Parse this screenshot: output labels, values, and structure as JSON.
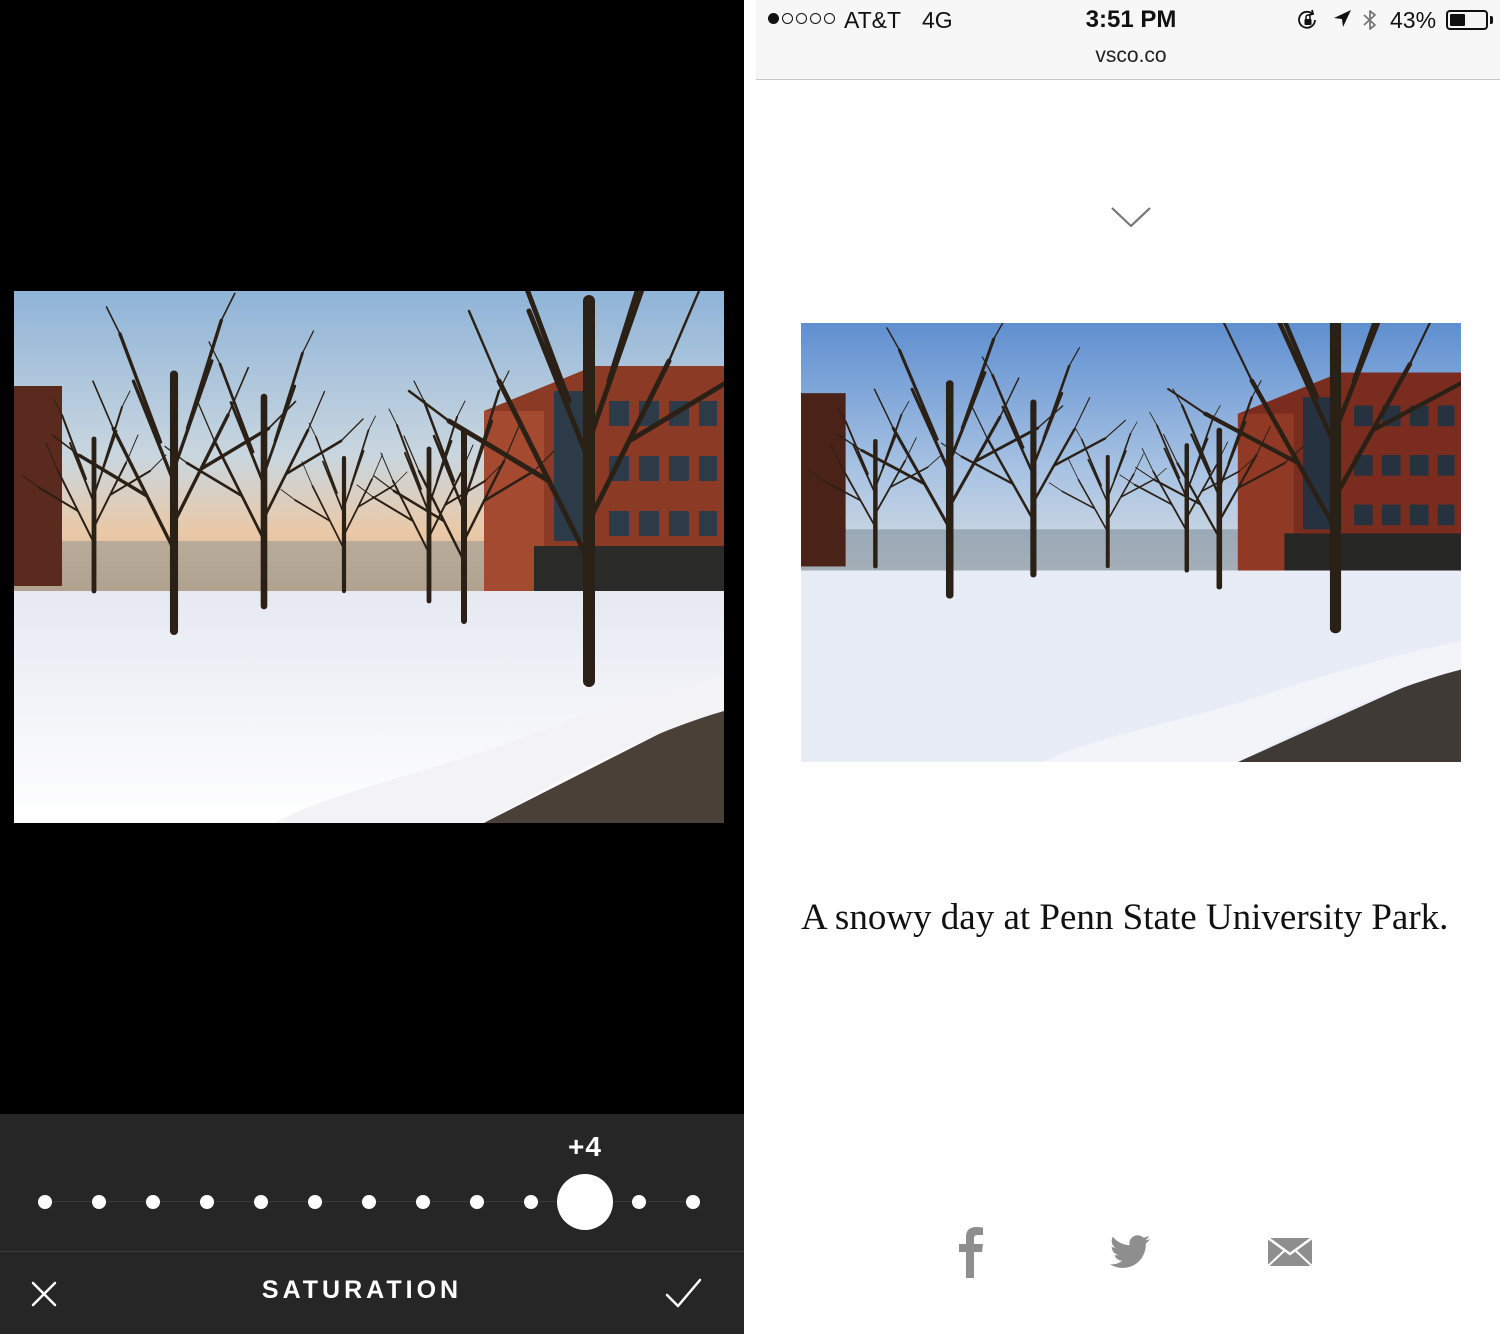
{
  "editor": {
    "slider": {
      "value_label": "+4",
      "value": 4,
      "min": -6,
      "max": 6,
      "dot_count": 13
    },
    "tool": {
      "label": "SATURATION",
      "cancel_icon": "close-icon",
      "confirm_icon": "checkmark-icon"
    }
  },
  "browser": {
    "status_bar": {
      "carrier": "AT&T",
      "network": "4G",
      "time": "3:51 PM",
      "battery_percent": "43%",
      "battery_level": 0.43,
      "signal_bars_filled": 1,
      "signal_bars_total": 5
    },
    "url": "vsco.co",
    "page": {
      "scroll_icon": "chevron-down-icon",
      "caption": "A snowy day at Penn State University Park.",
      "share": [
        {
          "name": "facebook",
          "icon": "facebook-icon"
        },
        {
          "name": "twitter",
          "icon": "twitter-icon"
        },
        {
          "name": "email",
          "icon": "email-icon"
        }
      ]
    }
  },
  "colors": {
    "editor_bg": "#000000",
    "panel_bg": "#262626",
    "share_icon": "#8e8e8e"
  }
}
